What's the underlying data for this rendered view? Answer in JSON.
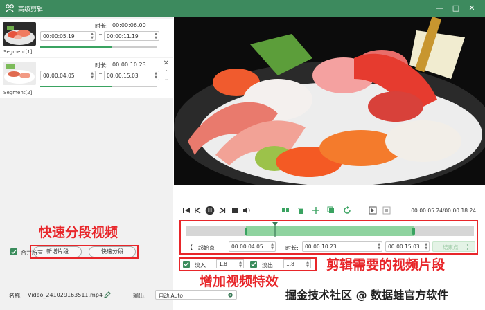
{
  "window": {
    "title": "高级剪辑"
  },
  "segments": [
    {
      "name": "Segment[1]",
      "duration_label": "时长:",
      "duration": "00:00:06.00",
      "start": "00:00:05.19",
      "end": "00:00:11.19",
      "progress": 0.62
    },
    {
      "name": "Segment[2]",
      "duration_label": "时长:",
      "duration": "00:00:10.23",
      "start": "00:00:04.05",
      "end": "00:00:15.03",
      "progress": 0.62
    }
  ],
  "left_actions": {
    "add_segment": "新增片段",
    "quick_split": "快速分段",
    "merge_all": "合并所有"
  },
  "annotations": {
    "quick_split": "快速分段视频",
    "cut_segment": "剪辑需要的视频片段",
    "add_effects": "增加视频特效"
  },
  "player": {
    "time": "00:00:05.24/00:00:18.24",
    "playhead_fraction": 0.31,
    "selection_start_fraction": 0.21,
    "selection_end_fraction": 0.79
  },
  "trim": {
    "start_point_label": "起始点",
    "start_value": "00:00:04.05",
    "duration_label": "时长:",
    "duration_value": "00:00:10.23",
    "end_value": "00:00:15.03",
    "end_point_label": "结束点"
  },
  "effects": {
    "fade_in_label": "淡入",
    "fade_in_value": "1.8",
    "fade_out_label": "淡出",
    "fade_out_value": "1.8"
  },
  "footer": {
    "name_label": "名称:",
    "file_name": "Video_241029163511.mp4",
    "output_label": "输出:",
    "output_value": "自动;Auto"
  },
  "watermark": "掘金技术社区 @ 数据蛙官方软件",
  "colors": {
    "brand_green": "#3d8a5e",
    "annotation_red": "#e8262a",
    "selection_green": "#8fd39f"
  }
}
